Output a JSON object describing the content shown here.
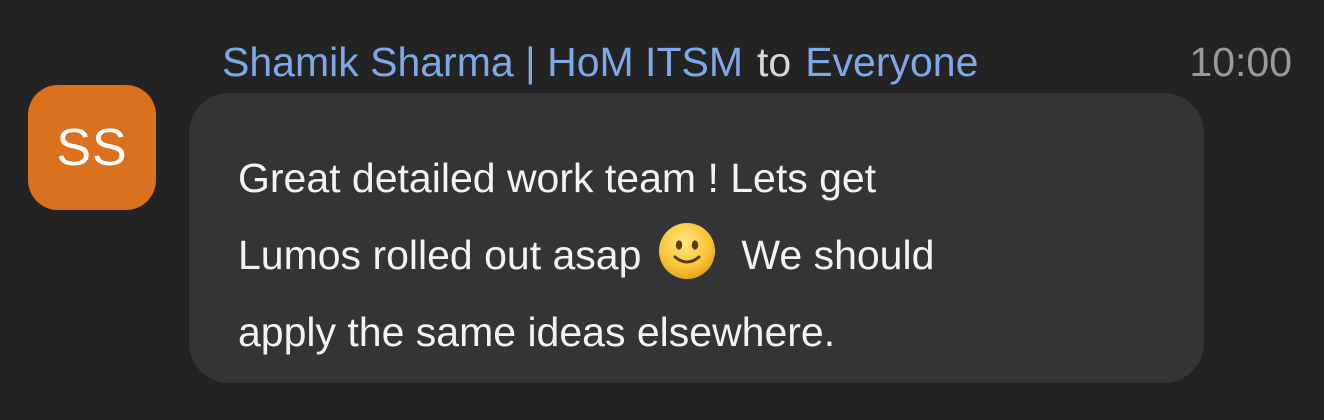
{
  "message": {
    "avatar_initials": "SS",
    "sender": "Shamik Sharma | HoM ITSM",
    "to_word": "to",
    "recipient": "Everyone",
    "timestamp": "10:00",
    "lines": {
      "line1": "Great detailed work team ! Lets get",
      "line2_before_emoji": "Lumos rolled out asap",
      "line2_after_emoji": "We should",
      "line3": "apply the same ideas elsewhere."
    },
    "emoji_name": "slightly-smiling-face-emoji"
  },
  "colors": {
    "background": "#232323",
    "bubble": "#343436",
    "avatar": "#d9711f",
    "name_link": "#7fa8e6",
    "timestamp": "#9a9a9a",
    "message_text": "#f3f3f3"
  }
}
